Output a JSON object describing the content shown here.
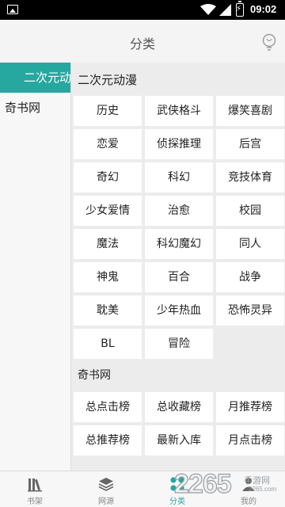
{
  "status_bar": {
    "time": "09:02"
  },
  "app_bar": {
    "title": "分类"
  },
  "sidebar": {
    "items": [
      {
        "label": "二次元动漫",
        "active": true
      },
      {
        "label": "奇书网",
        "active": false
      }
    ]
  },
  "sections": [
    {
      "title": "二次元动漫",
      "tags": [
        "历史",
        "武侠格斗",
        "爆笑喜剧",
        "恋爱",
        "侦探推理",
        "后宫",
        "奇幻",
        "科幻",
        "竞技体育",
        "少女爱情",
        "治愈",
        "校园",
        "魔法",
        "科幻魔幻",
        "同人",
        "神鬼",
        "百合",
        "战争",
        "耽美",
        "少年热血",
        "恐怖灵异",
        "BL",
        "冒险"
      ]
    },
    {
      "title": "奇书网",
      "tags": [
        "总点击榜",
        "总收藏榜",
        "月推荐榜",
        "总推荐榜",
        "最新入库",
        "月点击榜"
      ]
    }
  ],
  "bottom_nav": {
    "items": [
      {
        "label": "书架",
        "icon": "books-icon",
        "active": false
      },
      {
        "label": "网源",
        "icon": "layers-icon",
        "active": false
      },
      {
        "label": "分类",
        "icon": "grid-icon",
        "active": true
      },
      {
        "label": "我的",
        "icon": "profile-icon",
        "active": false
      }
    ]
  },
  "brand_watermark": {
    "logo": "2265",
    "sub": "手游网",
    "domain": "2265.com"
  },
  "colors": {
    "accent": "#26a7a0",
    "status_bar": "#000000",
    "background": "#ececec"
  }
}
